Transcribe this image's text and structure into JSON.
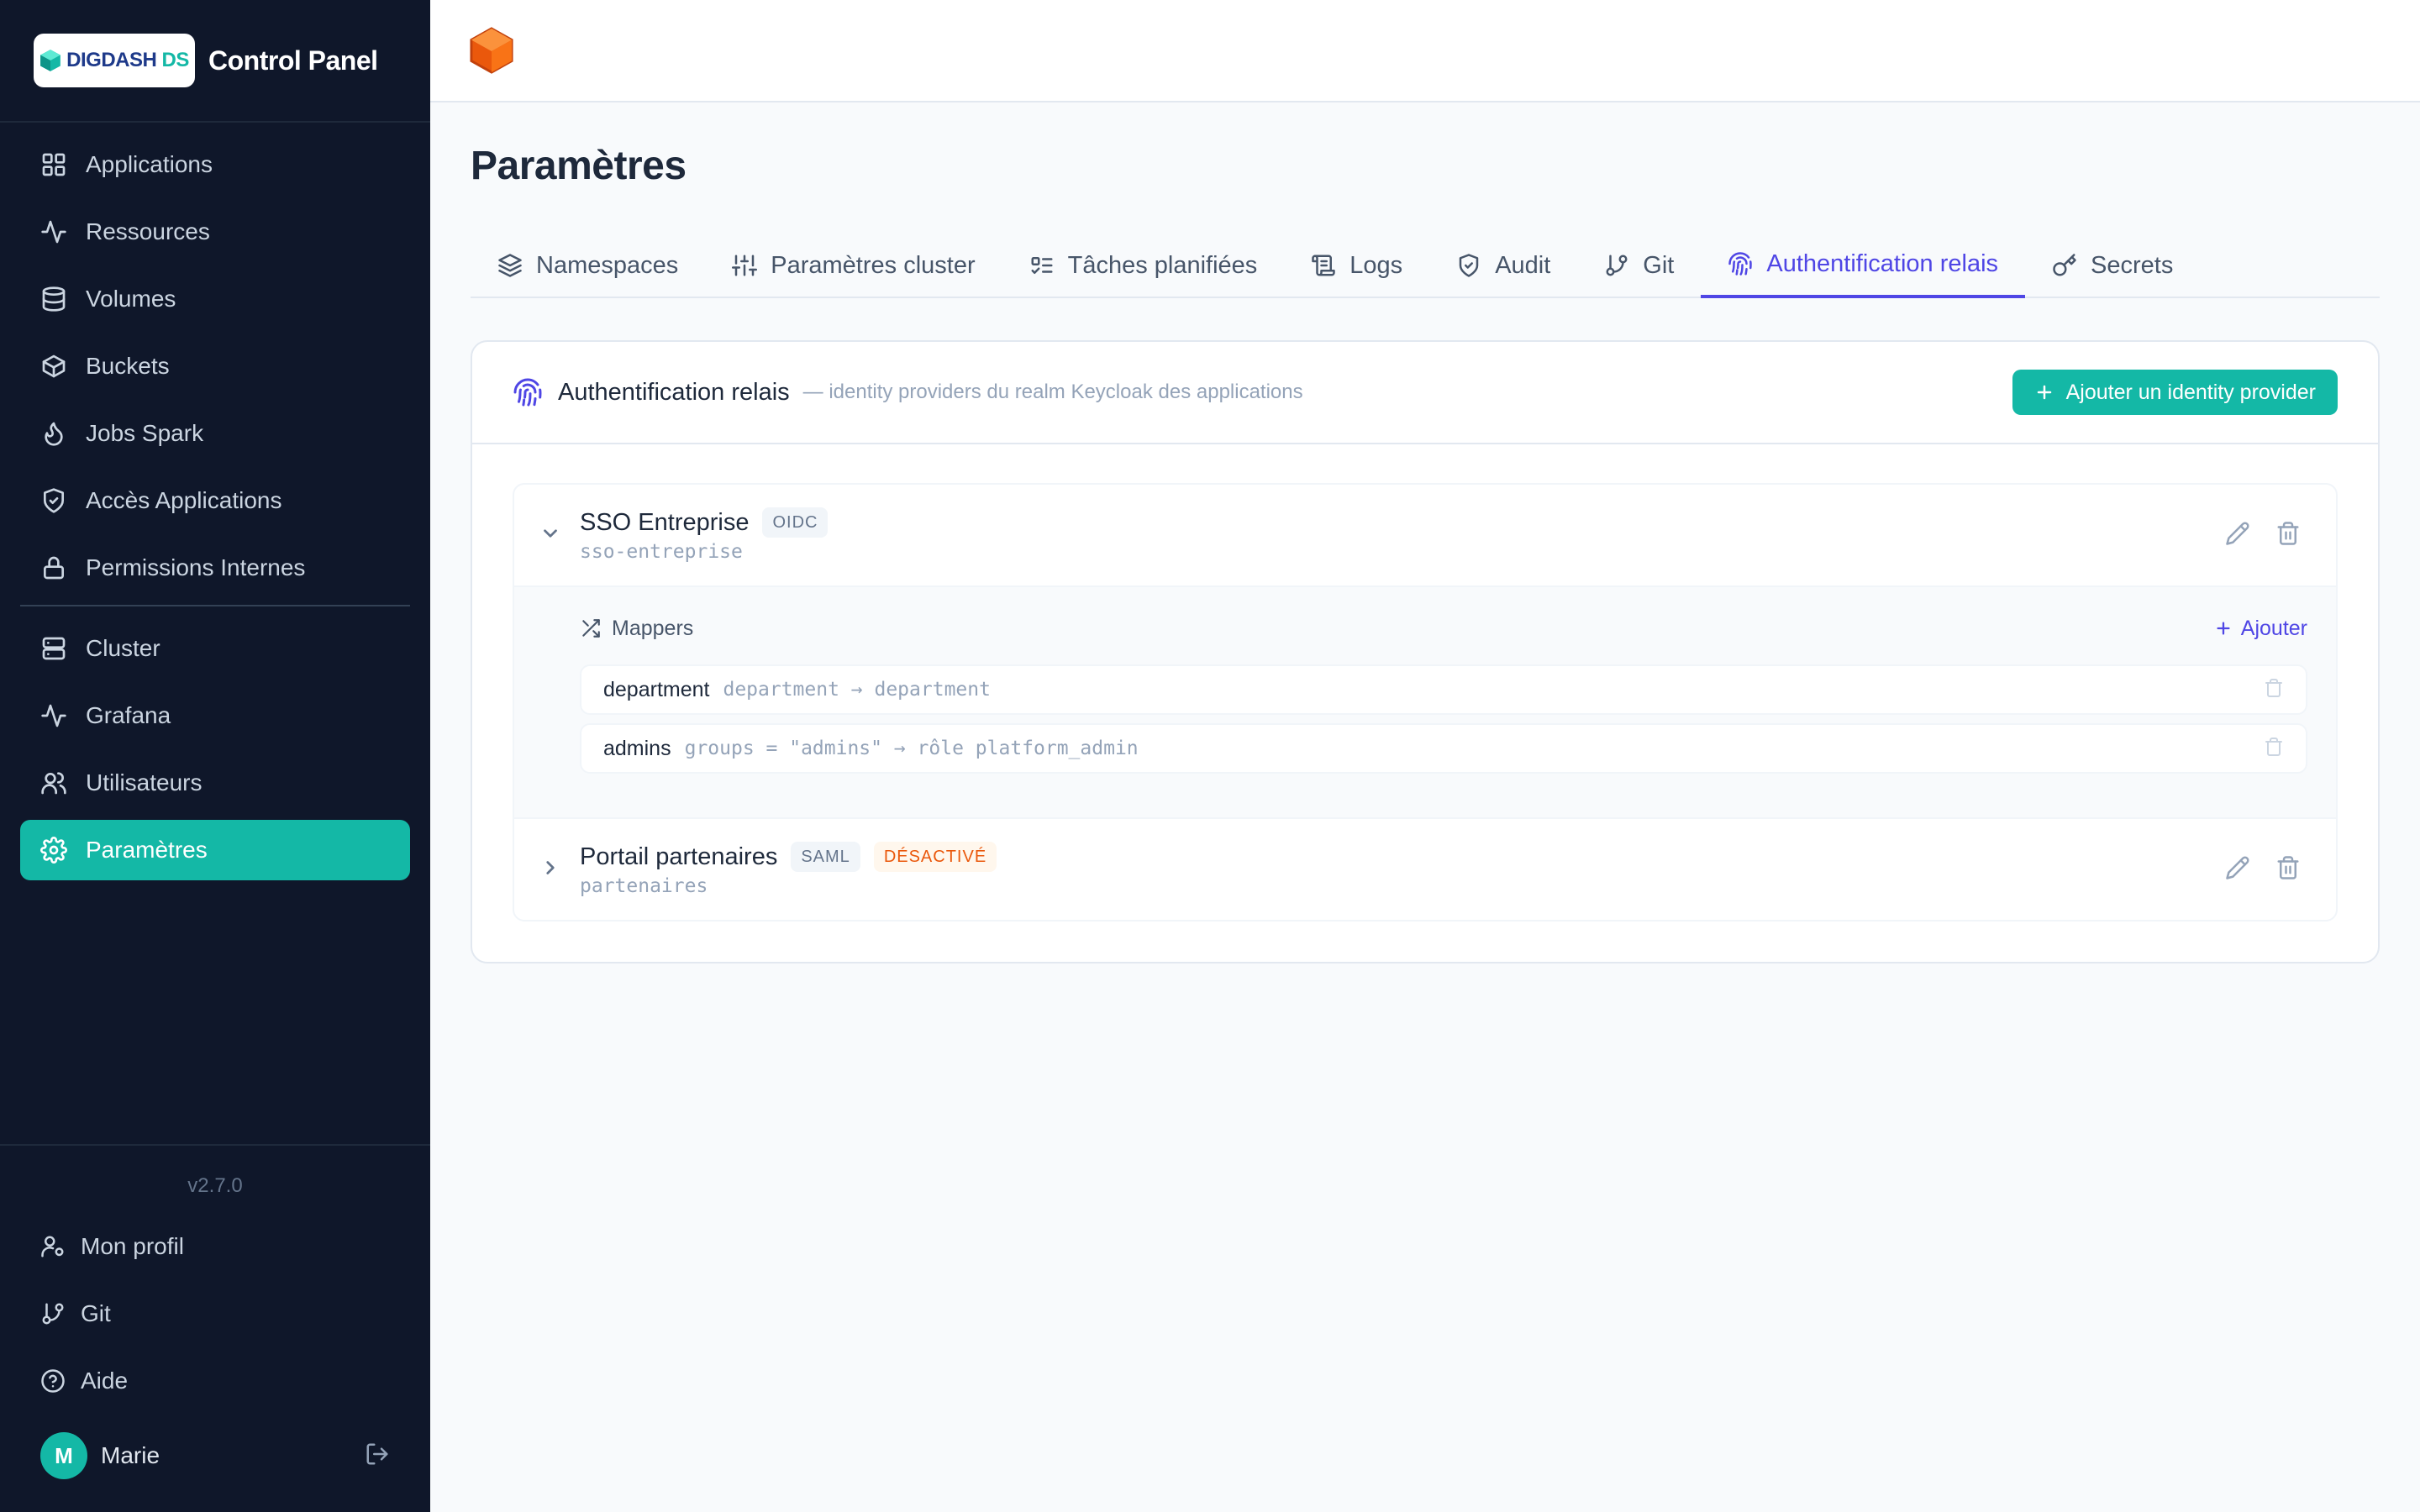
{
  "brand": {
    "logo_main": "DIGDASH",
    "logo_suffix": "DS",
    "title": "Control Panel"
  },
  "sidebar": {
    "items": [
      {
        "label": "Applications",
        "icon": "grid-icon"
      },
      {
        "label": "Ressources",
        "icon": "activity-icon"
      },
      {
        "label": "Volumes",
        "icon": "database-icon"
      },
      {
        "label": "Buckets",
        "icon": "box-icon"
      },
      {
        "label": "Jobs Spark",
        "icon": "flame-icon"
      },
      {
        "label": "Accès Applications",
        "icon": "shield-check-icon"
      },
      {
        "label": "Permissions Internes",
        "icon": "lock-icon"
      },
      {
        "label": "Cluster",
        "icon": "server-icon"
      },
      {
        "label": "Grafana",
        "icon": "activity-icon"
      },
      {
        "label": "Utilisateurs",
        "icon": "users-icon"
      },
      {
        "label": "Paramètres",
        "icon": "gear-icon",
        "active": true
      }
    ],
    "version": "v2.7.0",
    "bottom_items": [
      {
        "label": "Mon profil",
        "icon": "user-cog-icon"
      },
      {
        "label": "Git",
        "icon": "git-branch-icon"
      },
      {
        "label": "Aide",
        "icon": "help-circle-icon"
      }
    ],
    "user": {
      "initial": "M",
      "name": "Marie"
    }
  },
  "page": {
    "title": "Paramètres"
  },
  "tabs": [
    {
      "label": "Namespaces",
      "icon": "layers-icon"
    },
    {
      "label": "Paramètres cluster",
      "icon": "sliders-icon"
    },
    {
      "label": "Tâches planifiées",
      "icon": "list-todo-icon"
    },
    {
      "label": "Logs",
      "icon": "scroll-icon"
    },
    {
      "label": "Audit",
      "icon": "shield-check-icon"
    },
    {
      "label": "Git",
      "icon": "git-branch-icon"
    },
    {
      "label": "Authentification relais",
      "icon": "fingerprint-icon",
      "active": true
    },
    {
      "label": "Secrets",
      "icon": "key-icon"
    }
  ],
  "card": {
    "title": "Authentification relais",
    "subtitle": "— identity providers du realm Keycloak des applications",
    "add_button": "Ajouter un identity provider"
  },
  "providers": [
    {
      "name": "SSO Entreprise",
      "type_badge": "OIDC",
      "slug": "sso-entreprise",
      "expanded": true,
      "mappers_title": "Mappers",
      "add_mapper": "Ajouter",
      "mappers": [
        {
          "name": "department",
          "expr": "department → department"
        },
        {
          "name": "admins",
          "expr": "groups = \"admins\" → rôle platform_admin"
        }
      ]
    },
    {
      "name": "Portail partenaires",
      "type_badge": "SAML",
      "status_badge": "DÉSACTIVÉ",
      "slug": "partenaires",
      "expanded": false
    }
  ],
  "colors": {
    "sidebar_bg": "#0f172a",
    "accent": "#14b8a6",
    "tab_active": "#4f46e5",
    "disabled_badge": "#ea580c"
  }
}
